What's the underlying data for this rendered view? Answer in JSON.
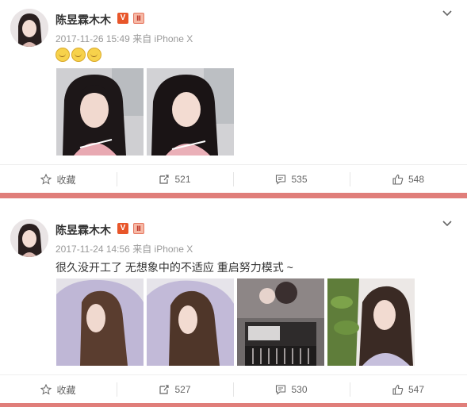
{
  "posts": [
    {
      "author": "陈昱霖木木",
      "badge_v": "V",
      "badge_m": "Ⅱ",
      "meta": "2017-11-26 15:49 来自 iPhone X",
      "text": "",
      "emoji_count": 3,
      "images": [
        "selfie-portrait",
        "selfie-portrait"
      ],
      "actions": {
        "favorite": "收藏",
        "repost": "521",
        "comment": "535",
        "like": "548"
      }
    },
    {
      "author": "陈昱霖木木",
      "badge_v": "V",
      "badge_m": "Ⅱ",
      "meta": "2017-11-24 14:56 来自 iPhone X",
      "text": "很久没开工了  无想象中的不适应    重启努力模式 ~",
      "emoji_count": 0,
      "images": [
        "hoodie-portrait",
        "hoodie-portrait",
        "makeup-scene",
        "plant-portrait"
      ],
      "actions": {
        "favorite": "收藏",
        "repost": "527",
        "comment": "530",
        "like": "547"
      }
    }
  ],
  "colors": {
    "accent": "#e8562a",
    "separator": "#e07e7a",
    "meta": "#999999"
  }
}
